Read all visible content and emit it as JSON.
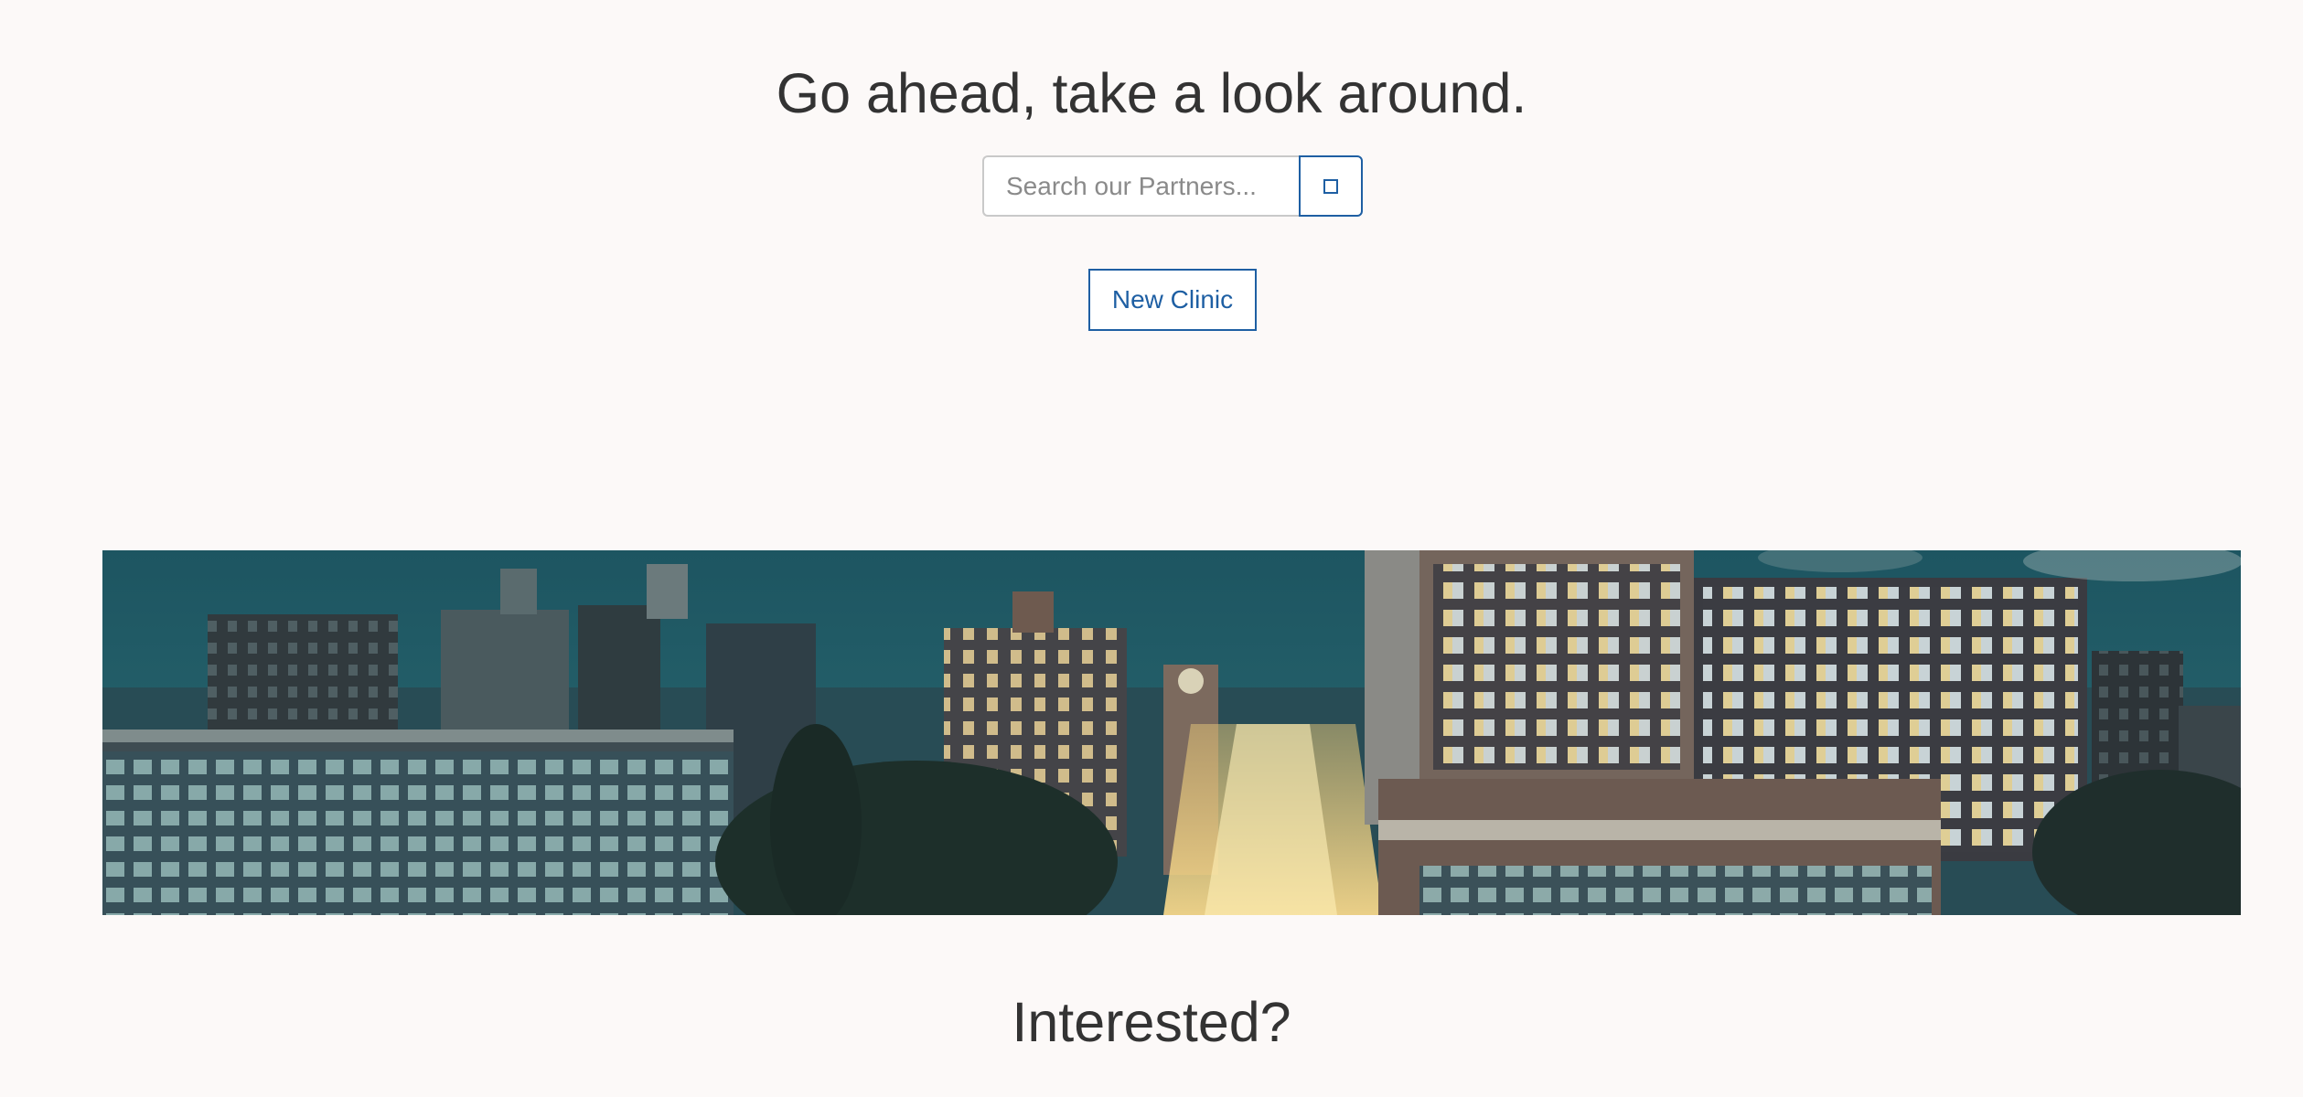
{
  "main": {
    "heading": "Go ahead, take a look around.",
    "search": {
      "placeholder": "Search our Partners...",
      "button_icon": "search-icon"
    },
    "new_clinic_label": "New Clinic"
  },
  "banner": {
    "image": "city-night-skyline-photo"
  },
  "interest": {
    "heading": "Interested?"
  },
  "colors": {
    "background": "#fcf9f8",
    "accent": "#1e5fa3",
    "text": "#333333"
  }
}
